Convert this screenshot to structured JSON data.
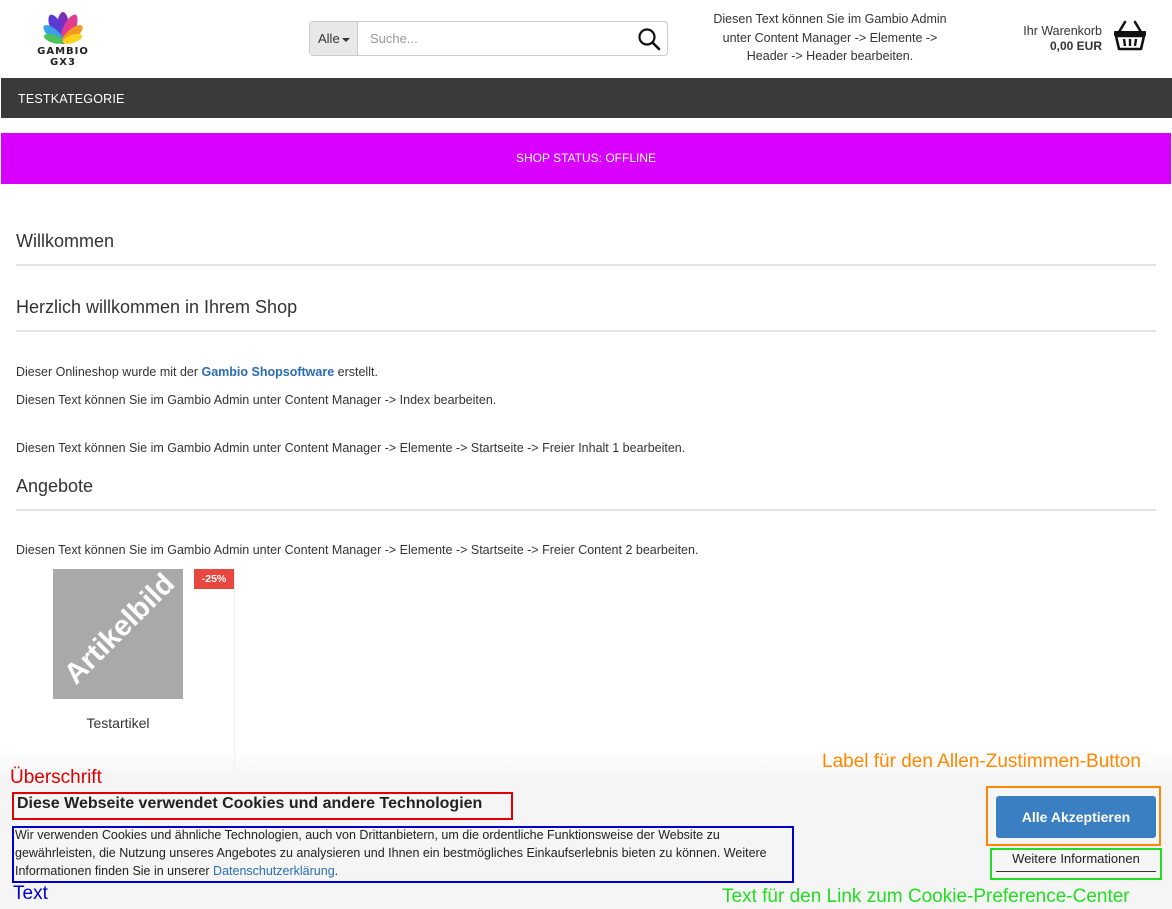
{
  "header": {
    "logo_text": "GAMBIO GX3",
    "search": {
      "category": "Alle",
      "placeholder": "Suche..."
    },
    "info_lines": [
      "Diesen Text können Sie im Gambio Admin",
      "unter Content Manager -> Elemente ->",
      "Header -> Header bearbeiten."
    ],
    "cart": {
      "label": "Ihr Warenkorb",
      "amount": "0,00 EUR"
    }
  },
  "nav": {
    "items": [
      "TESTKATEGORIE"
    ]
  },
  "status_banner": "SHOP STATUS: OFFLINE",
  "main": {
    "welcome_heading": "Willkommen",
    "shop_heading": "Herzlich willkommen in Ihrem Shop",
    "intro_before": "Dieser Onlineshop wurde mit der ",
    "intro_link": "Gambio Shopsoftware",
    "intro_after": " erstellt.",
    "index_text": "Diesen Text können Sie im Gambio Admin unter Content Manager -> Index bearbeiten.",
    "free_content_1": "Diesen Text können Sie im Gambio Admin unter Content Manager -> Elemente -> Startseite -> Freier Inhalt 1 bearbeiten.",
    "offers_heading": "Angebote",
    "free_content_2": "Diesen Text können Sie im Gambio Admin unter Content Manager -> Elemente -> Startseite -> Freier Content 2 bearbeiten.",
    "product": {
      "image_text": "Artikelbild",
      "discount": "-25%",
      "name": "Testartikel"
    }
  },
  "cookie_banner": {
    "title": "Diese Webseite verwendet Cookies und andere Technologien",
    "text_line1": "Wir verwenden Cookies und ähnliche Technologien, auch von Drittanbietern, um die ordentliche Funktionsweise der Website zu",
    "text_line2": "gewährleisten, die Nutzung unseres Angebotes zu analysieren und Ihnen ein bestmögliches Einkaufserlebnis bieten zu können. Weitere",
    "text_line3_before": "Informationen finden Sie in unserer ",
    "privacy_link": "Datenschutzerklärung",
    "text_line3_after": ".",
    "accept_label": "Alle Akzeptieren",
    "more_info_label": "Weitere Informationen"
  },
  "annotations": {
    "heading_label": "Überschrift",
    "text_label": "Text",
    "accept_label": "Label für den Allen-Zustimmen-Button",
    "link_label": "Text für den Link zum Cookie-Preference-Center",
    "colors": {
      "heading": "#e00000",
      "text": "#0000cc",
      "accept": "#ff8800",
      "link": "#22dd22"
    }
  },
  "colors": {
    "nav_bg": "#3a3a3a",
    "status_bg": "#d900ff",
    "accept_bg": "#3a7fc1",
    "discount_bg": "#e8473f",
    "link": "#2a6db5"
  }
}
